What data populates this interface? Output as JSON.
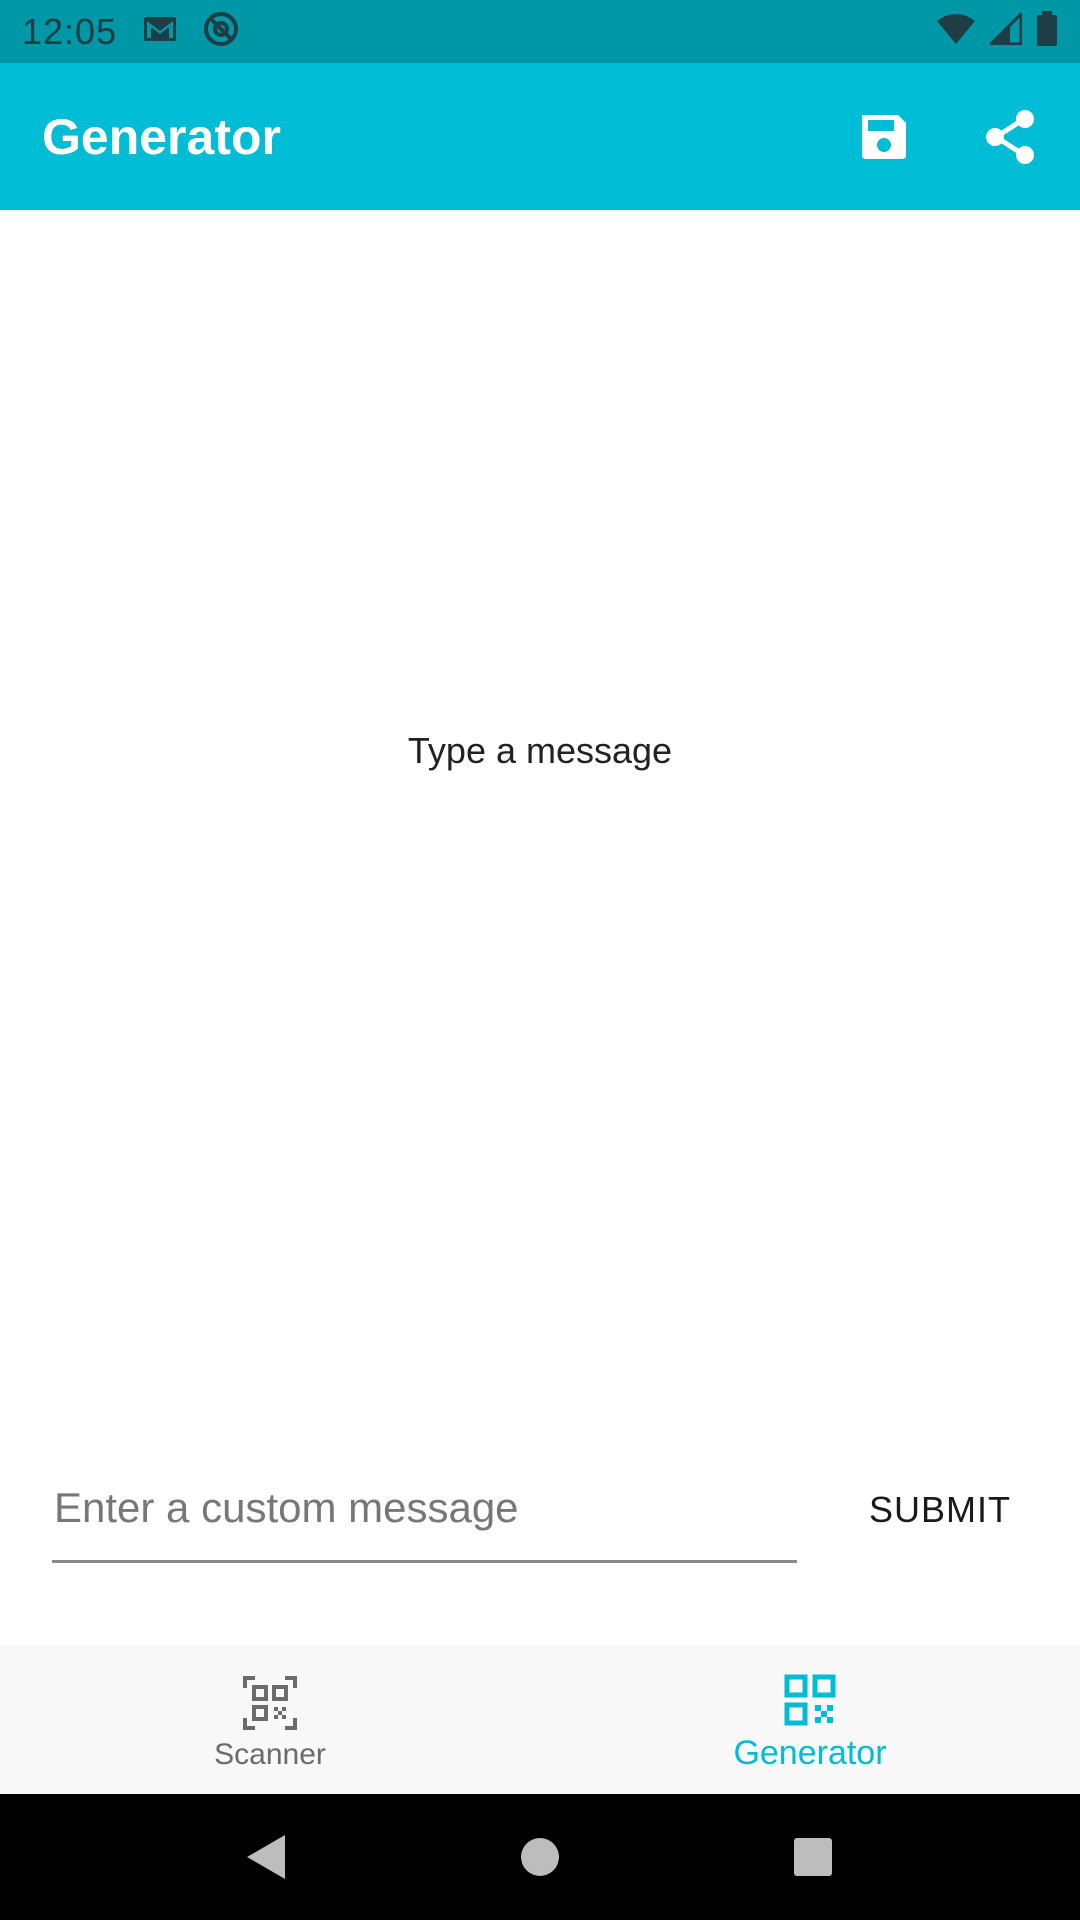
{
  "status_bar": {
    "time": "12:05",
    "icons": [
      "gmail-icon",
      "at-sign-icon",
      "wifi-icon",
      "signal-icon",
      "battery-icon"
    ]
  },
  "app_bar": {
    "title": "Generator",
    "actions": [
      "save-icon",
      "share-icon"
    ],
    "color": "#00BCD4"
  },
  "main": {
    "qr_placeholder_text": "Type a message"
  },
  "input": {
    "placeholder": "Enter a custom message",
    "value": "",
    "submit_label": "SUBMIT"
  },
  "bottom_nav": {
    "items": [
      {
        "label": "Scanner",
        "icon": "qr-scanner-icon",
        "active": false
      },
      {
        "label": "Generator",
        "icon": "qr-code-icon",
        "active": true
      }
    ],
    "active_color": "#00BCD4",
    "inactive_color": "#6b6b6b"
  },
  "system_nav": {
    "buttons": [
      "back-icon",
      "home-icon",
      "recents-icon"
    ]
  }
}
